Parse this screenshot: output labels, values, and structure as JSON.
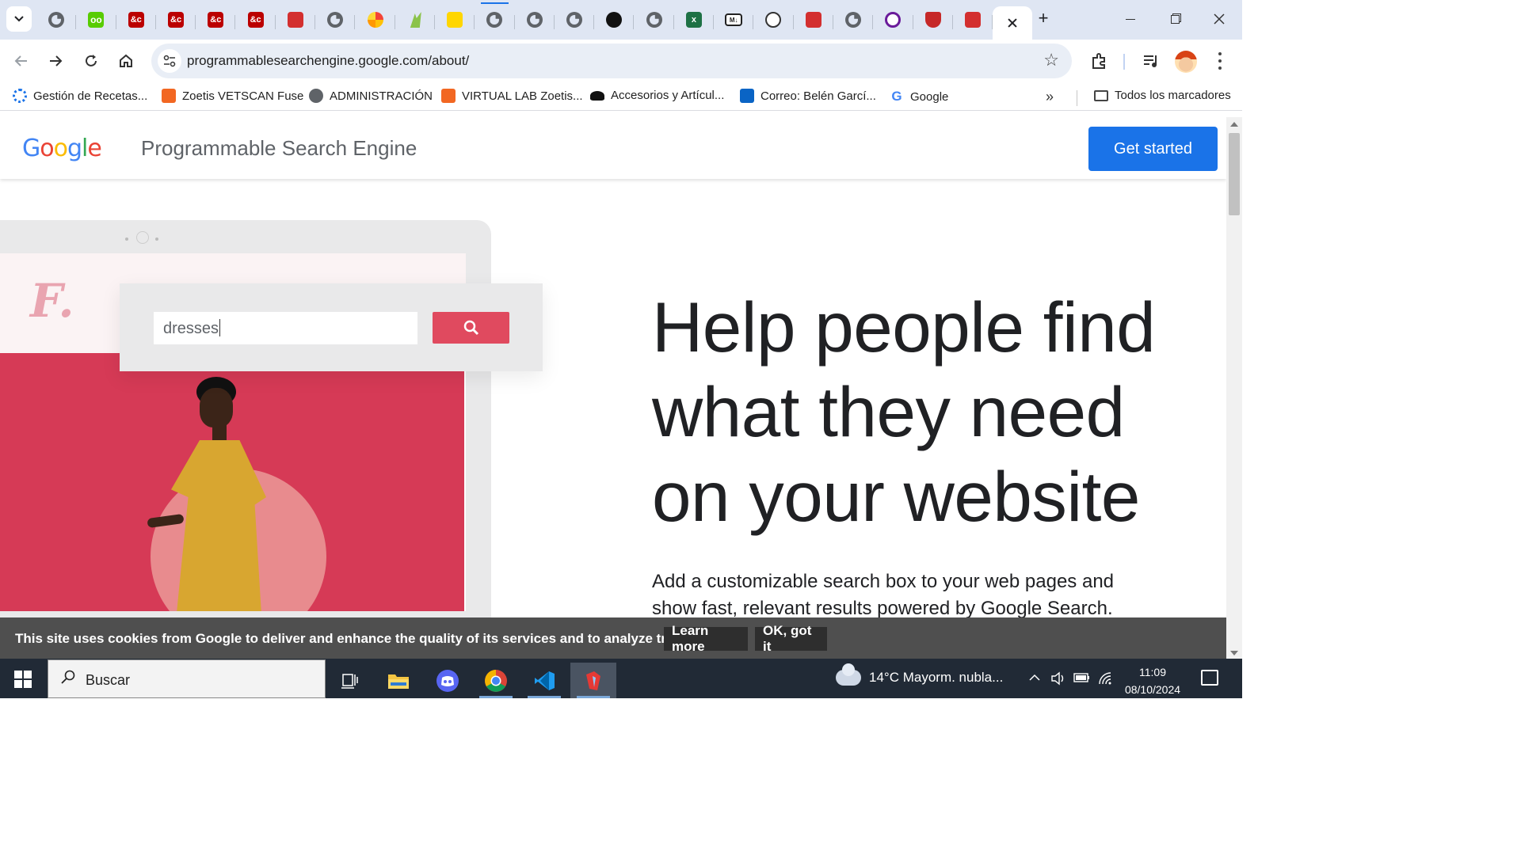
{
  "browser": {
    "tabs": [
      {
        "icon": "globe-icon"
      },
      {
        "icon": "duolingo-icon",
        "glyph": "oo"
      },
      {
        "icon": "ampersand-icon",
        "glyph": "&c"
      },
      {
        "icon": "ampersand-icon",
        "glyph": "&c"
      },
      {
        "icon": "ampersand-icon",
        "glyph": "&c"
      },
      {
        "icon": "ampersand-icon",
        "glyph": "&c"
      },
      {
        "icon": "pdf-icon"
      },
      {
        "icon": "globe-icon"
      },
      {
        "icon": "pie-chart-icon"
      },
      {
        "icon": "leaf-icon"
      },
      {
        "icon": "pencil-icon"
      },
      {
        "icon": "globe-icon"
      },
      {
        "icon": "globe-icon"
      },
      {
        "icon": "globe-icon"
      },
      {
        "icon": "github-icon"
      },
      {
        "icon": "globe-icon"
      },
      {
        "icon": "excel-icon",
        "glyph": "x"
      },
      {
        "icon": "markdown-icon",
        "glyph": "M↓"
      },
      {
        "icon": "chatgpt-icon"
      },
      {
        "icon": "pdf-icon"
      },
      {
        "icon": "globe-icon"
      },
      {
        "icon": "ring-icon"
      },
      {
        "icon": "crest-icon"
      },
      {
        "icon": "pdf-icon"
      }
    ],
    "url": "programmablesearchengine.google.com/about/",
    "bookmarks": [
      {
        "label": "Gestión de Recetas...",
        "color": "#1a73e8"
      },
      {
        "label": "Zoetis VETSCAN Fuse",
        "color": "#f26722"
      },
      {
        "label": "ADMINISTRACIÓN",
        "color": "#5f6368"
      },
      {
        "label": "VIRTUAL LAB Zoetis...",
        "color": "#f26722"
      },
      {
        "label": "Accesorios y Artícul...",
        "color": "#111111"
      },
      {
        "label": "Correo: Belén Garcí...",
        "color": "#0a64c5"
      },
      {
        "label": "Google",
        "color": "#4285f4"
      }
    ],
    "all_bookmarks": "Todos los marcadores",
    "more_chevrons": "»"
  },
  "site": {
    "logo": [
      "G",
      "o",
      "o",
      "g",
      "l",
      "e"
    ],
    "title": "Programmable Search Engine",
    "cta": "Get started",
    "brand_letter": "F.",
    "search_value": "dresses",
    "headline": "Help people find what they need on your website",
    "subtext": "Add a customizable search box to your web pages and show fast, relevant results powered by Google Search."
  },
  "cookie": {
    "text": "This site uses cookies from Google to deliver and enhance the quality of its services and to analyze traffic.",
    "learn_more": "Learn more",
    "ok": "OK, got it"
  },
  "taskbar": {
    "search_placeholder": "Buscar",
    "apps": [
      "task-view-icon",
      "file-explorer-icon",
      "discord-icon",
      "chrome-icon",
      "vscode-icon",
      "app-icon"
    ],
    "weather": "14°C  Mayorm. nubla...",
    "time": "11:09",
    "date": "08/10/2024"
  },
  "colors": {
    "accent": "#1a73e8",
    "search_button": "#e04a5f",
    "hero_red": "#d63a56",
    "cookie_bg": "#4f4f4f"
  }
}
